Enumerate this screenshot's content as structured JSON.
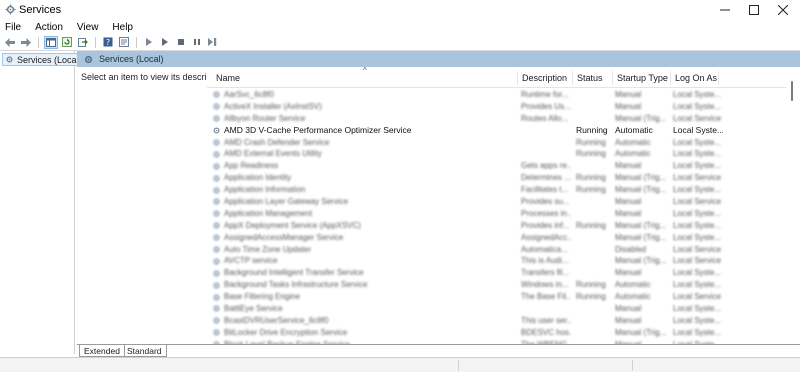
{
  "window": {
    "title": "Services",
    "icons": {
      "app": "gear-icon",
      "minimize": "minimize-icon",
      "maximize": "maximize-icon",
      "close": "close-icon"
    }
  },
  "menu": [
    "File",
    "Action",
    "View",
    "Help"
  ],
  "toolbar": [
    "back-arrow-icon",
    "forward-arrow-icon",
    "console-tree-icon",
    "refresh-icon",
    "export-icon",
    "help-icon",
    "properties-icon",
    "play-icon",
    "play-alt-icon",
    "stop-icon",
    "pause-icon",
    "restart-icon"
  ],
  "tree": {
    "label": "Services (Local)"
  },
  "pane": {
    "header": "Services (Local)",
    "description_hint": "Select an item to view its description.",
    "columns": {
      "name": "Name",
      "description": "Description",
      "status": "Status",
      "startup": "Startup Type",
      "logon": "Log On As"
    }
  },
  "services": [
    {
      "name": "AarSvc_6c8f0",
      "description": "Runtime for...",
      "status": "",
      "startup": "Manual",
      "logon": "Local Syste...",
      "blur": true
    },
    {
      "name": "ActiveX Installer (AxInstSV)",
      "description": "Provides Us...",
      "status": "",
      "startup": "Manual",
      "logon": "Local Syste...",
      "blur": true
    },
    {
      "name": "Allbyon Router Service",
      "description": "Routes Allo...",
      "status": "",
      "startup": "Manual (Trig...",
      "logon": "Local Service",
      "blur": true
    },
    {
      "name": "AMD 3D V-Cache Performance Optimizer Service",
      "description": "",
      "status": "Running",
      "startup": "Automatic",
      "logon": "Local Syste...",
      "blur": false
    },
    {
      "name": "AMD Crash Defender Service",
      "description": "",
      "status": "Running",
      "startup": "Automatic",
      "logon": "Local Syste...",
      "blur": true
    },
    {
      "name": "AMD External Events Utility",
      "description": "",
      "status": "Running",
      "startup": "Automatic",
      "logon": "Local Syste...",
      "blur": true
    },
    {
      "name": "App Readiness",
      "description": "Gets apps re...",
      "status": "",
      "startup": "Manual",
      "logon": "Local Syste...",
      "blur": true
    },
    {
      "name": "Application Identity",
      "description": "Determines ...",
      "status": "Running",
      "startup": "Manual (Trig...",
      "logon": "Local Service",
      "blur": true
    },
    {
      "name": "Application Information",
      "description": "Facilitates t...",
      "status": "Running",
      "startup": "Manual (Trig...",
      "logon": "Local Syste...",
      "blur": true
    },
    {
      "name": "Application Layer Gateway Service",
      "description": "Provides su...",
      "status": "",
      "startup": "Manual",
      "logon": "Local Service",
      "blur": true
    },
    {
      "name": "Application Management",
      "description": "Processes in...",
      "status": "",
      "startup": "Manual",
      "logon": "Local Syste...",
      "blur": true
    },
    {
      "name": "AppX Deployment Service (AppXSVC)",
      "description": "Provides inf...",
      "status": "Running",
      "startup": "Manual (Trig...",
      "logon": "Local Syste...",
      "blur": true
    },
    {
      "name": "AssignedAccessManager Service",
      "description": "AssignedAcc...",
      "status": "",
      "startup": "Manual (Trig...",
      "logon": "Local Syste...",
      "blur": true
    },
    {
      "name": "Auto Time Zone Updater",
      "description": "Automatica...",
      "status": "",
      "startup": "Disabled",
      "logon": "Local Service",
      "blur": true
    },
    {
      "name": "AVCTP service",
      "description": "This is Audi...",
      "status": "",
      "startup": "Manual (Trig...",
      "logon": "Local Service",
      "blur": true
    },
    {
      "name": "Background Intelligent Transfer Service",
      "description": "Transfers fil...",
      "status": "",
      "startup": "Manual",
      "logon": "Local Syste...",
      "blur": true
    },
    {
      "name": "Background Tasks Infrastructure Service",
      "description": "Windows in...",
      "status": "Running",
      "startup": "Automatic",
      "logon": "Local Syste...",
      "blur": true
    },
    {
      "name": "Base Filtering Engine",
      "description": "The Base Fil...",
      "status": "Running",
      "startup": "Automatic",
      "logon": "Local Service",
      "blur": true
    },
    {
      "name": "BattlEye Service",
      "description": "",
      "status": "",
      "startup": "Manual",
      "logon": "Local Syste...",
      "blur": true
    },
    {
      "name": "BcastDVRUserService_6c8f0",
      "description": "This user ser...",
      "status": "",
      "startup": "Manual",
      "logon": "Local Syste...",
      "blur": true
    },
    {
      "name": "BitLocker Drive Encryption Service",
      "description": "BDESVC hos...",
      "status": "",
      "startup": "Manual (Trig...",
      "logon": "Local Syste...",
      "blur": true
    },
    {
      "name": "Block Level Backup Engine Service",
      "description": "The WBENG...",
      "status": "",
      "startup": "Manual",
      "logon": "Local Syste...",
      "blur": true
    }
  ],
  "tabs": {
    "extended": "Extended",
    "standard": "Standard"
  }
}
